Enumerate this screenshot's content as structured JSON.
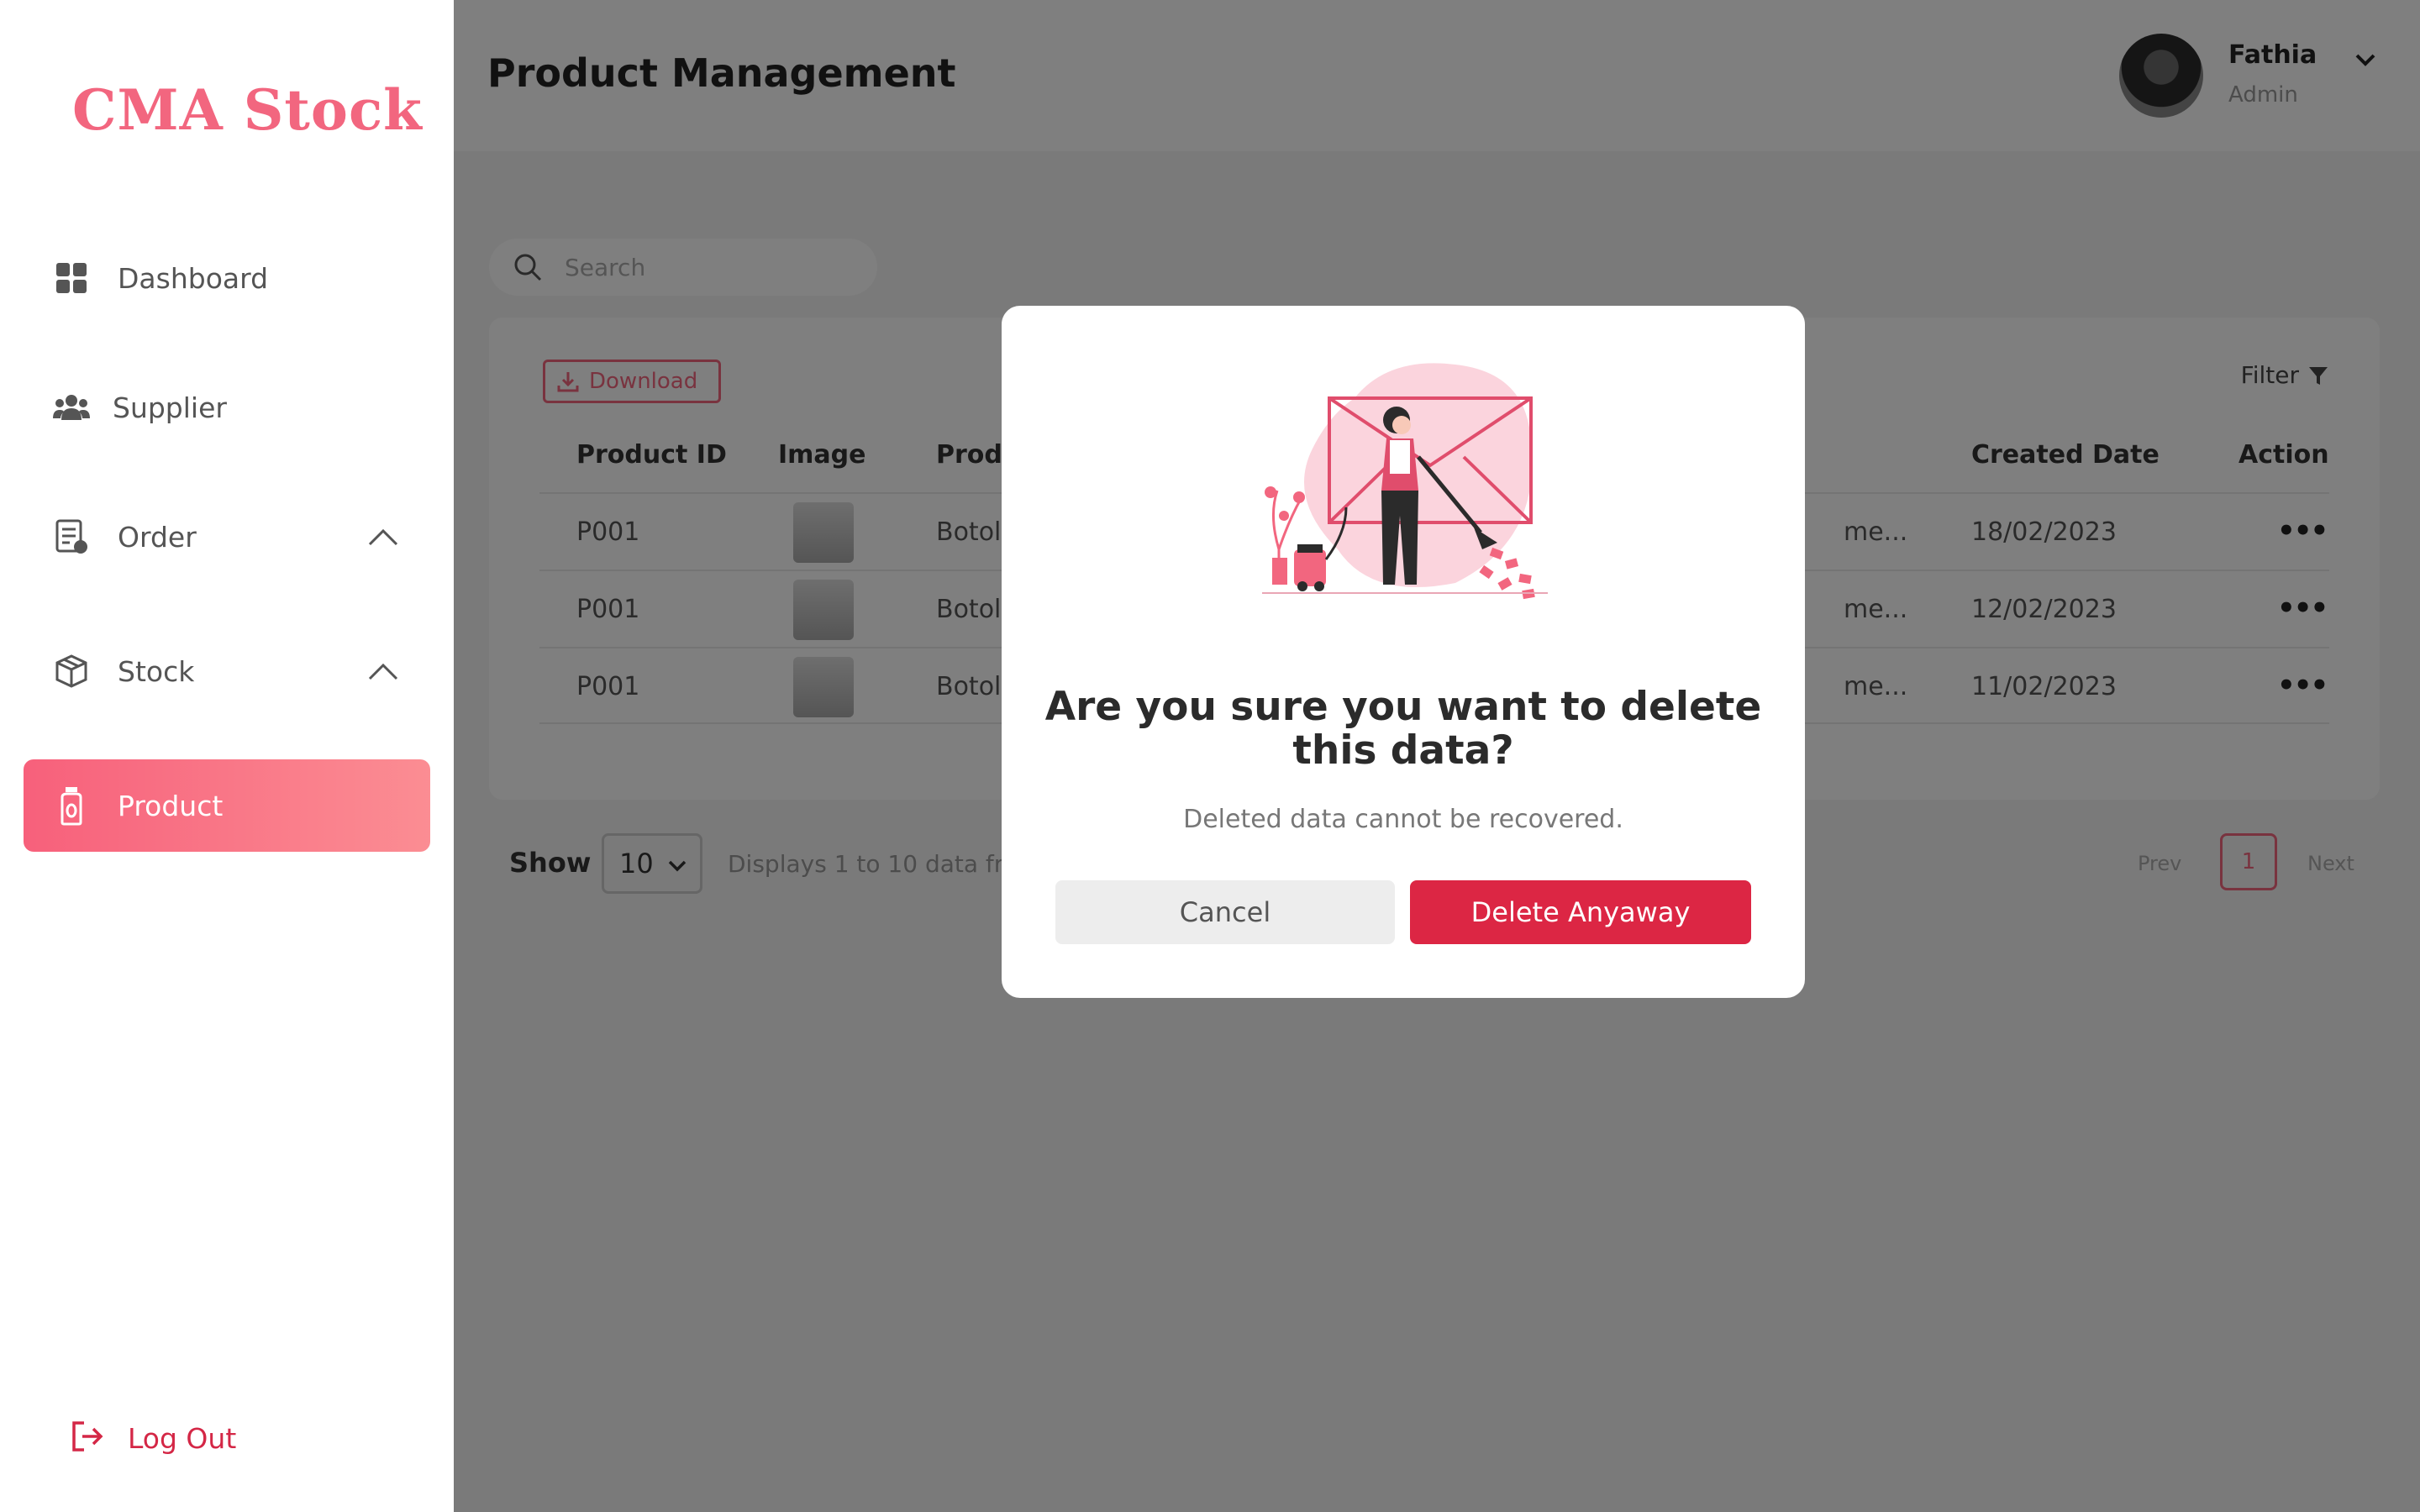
{
  "app": {
    "logo_text": "CMA Stock",
    "page_title": "Product Management"
  },
  "sidebar": {
    "items": [
      {
        "label": "Dashboard",
        "icon": "grid-icon"
      },
      {
        "label": "Supplier",
        "icon": "users-icon"
      },
      {
        "label": "Order",
        "icon": "order-icon"
      },
      {
        "label": "Stock",
        "icon": "box-icon"
      },
      {
        "label": "Product",
        "icon": "bottle-icon",
        "active": true
      }
    ],
    "logout_label": "Log Out"
  },
  "user": {
    "name": "Fathia",
    "role": "Admin"
  },
  "search": {
    "placeholder": "Search"
  },
  "toolbar": {
    "download_label": "Download",
    "filter_label": "Filter"
  },
  "table": {
    "columns": [
      "Product ID",
      "Image",
      "Prod",
      "Created Date",
      "Action"
    ],
    "rows": [
      {
        "id": "P001",
        "name": "Botol",
        "supplier": "me...",
        "created": "18/02/2023"
      },
      {
        "id": "P001",
        "name": "Botol",
        "supplier": "me...",
        "created": "12/02/2023"
      },
      {
        "id": "P001",
        "name": "Botol",
        "supplier": "me...",
        "created": "11/02/2023"
      }
    ]
  },
  "pagination": {
    "show_label": "Show",
    "page_size": "10",
    "displays_text": "Displays 1 to 10 data fr",
    "prev": "Prev",
    "current": "1",
    "next": "Next"
  },
  "modal": {
    "title": "Are you sure you want to delete this data?",
    "subtitle": "Deleted data cannot be recovered.",
    "cancel_label": "Cancel",
    "delete_label": "Delete Anyaway"
  },
  "colors": {
    "accent": "#f2667f",
    "danger": "#dc2644"
  }
}
